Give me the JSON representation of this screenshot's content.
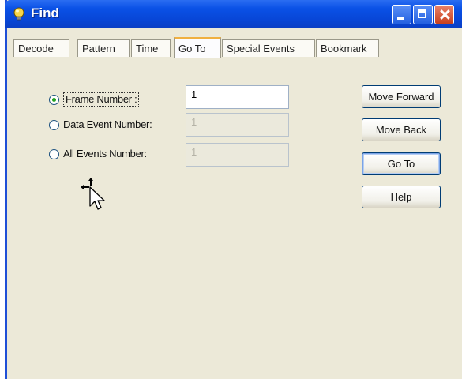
{
  "window": {
    "title": "Find"
  },
  "tabs": [
    {
      "label": "Decode"
    },
    {
      "label": "Pattern"
    },
    {
      "label": "Time"
    },
    {
      "label": "Go To"
    },
    {
      "label": "Special Events"
    },
    {
      "label": "Bookmark"
    }
  ],
  "active_tab": "Go To",
  "options": [
    {
      "label": "Frame Number :",
      "checked": true,
      "value": "1",
      "enabled": true
    },
    {
      "label": "Data Event Number:",
      "checked": false,
      "value": "1",
      "enabled": false
    },
    {
      "label": "All Events Number:",
      "checked": false,
      "value": "1",
      "enabled": false
    }
  ],
  "buttons": {
    "move_forward": "Move Forward",
    "move_back": "Move Back",
    "go_to": "Go To",
    "help": "Help"
  },
  "colors": {
    "titlebar": "#0a51e6",
    "dialog_bg": "#ece9d8",
    "radio_dot": "#21a121"
  },
  "icons": {
    "title": "bulb-icon",
    "cursor": "move-cursor-icon"
  }
}
